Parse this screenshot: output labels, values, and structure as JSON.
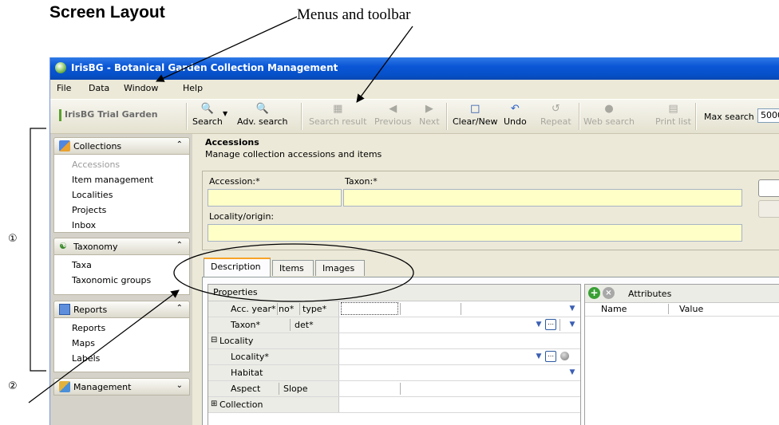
{
  "annotations": {
    "heading": "Screen Layout",
    "menus_toolbar_label": "Menus and toolbar",
    "marker_1": "①",
    "marker_2": "②"
  },
  "window": {
    "title": "IrisBG - Botanical Garden Collection Management",
    "menu": [
      "File",
      "Data",
      "Window",
      "Help"
    ]
  },
  "toolbar": {
    "garden": "IrisBG Trial Garden",
    "buttons": [
      {
        "label": "Search",
        "icon": "binoculars-icon",
        "enabled": true
      },
      {
        "label": "Adv. search",
        "icon": "binoculars-plus-icon",
        "enabled": true
      },
      {
        "label": "Search result",
        "icon": "grid-icon",
        "enabled": false
      },
      {
        "label": "Previous",
        "icon": "arrow-left-icon",
        "enabled": false
      },
      {
        "label": "Next",
        "icon": "arrow-right-icon",
        "enabled": false
      },
      {
        "label": "Clear/New",
        "icon": "new-window-icon",
        "enabled": true
      },
      {
        "label": "Undo",
        "icon": "undo-icon",
        "enabled": true
      },
      {
        "label": "Repeat",
        "icon": "repeat-icon",
        "enabled": false
      },
      {
        "label": "Web search",
        "icon": "web-search-icon",
        "enabled": false
      },
      {
        "label": "Print list",
        "icon": "print-icon",
        "enabled": false
      }
    ],
    "max_search_label": "Max search",
    "max_search_value": "5000"
  },
  "nav": {
    "sections": [
      {
        "title": "Collections",
        "items": [
          "Accessions",
          "Item management",
          "Localities",
          "Projects",
          "Inbox"
        ]
      },
      {
        "title": "Taxonomy",
        "items": [
          "Taxa",
          "Taxonomic groups"
        ]
      },
      {
        "title": "Reports",
        "items": [
          "Reports",
          "Maps",
          "Labels"
        ]
      },
      {
        "title": "Management",
        "items": []
      }
    ]
  },
  "main": {
    "title": "Accessions",
    "subtitle": "Manage collection accessions and items",
    "fields": {
      "accession_label": "Accession:*",
      "taxon_label": "Taxon:*",
      "locality_label": "Locality/origin:"
    },
    "tabs": [
      "Description",
      "Items",
      "Images"
    ],
    "properties_header": "Properties",
    "rows": {
      "accyear": "Acc. year*",
      "no": "no*",
      "type": "type*",
      "taxon": "Taxon*",
      "det": "det*",
      "locality_group": "Locality",
      "locality": "Locality*",
      "habitat": "Habitat",
      "aspect": "Aspect",
      "slope": "Slope",
      "collection_group": "Collection"
    },
    "attributes_title": "Attributes",
    "attr_cols": [
      "Name",
      "Value"
    ]
  }
}
